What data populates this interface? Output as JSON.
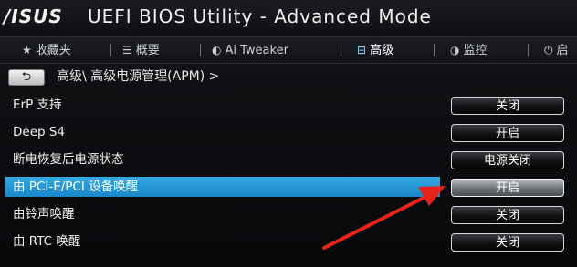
{
  "titlebar": {
    "logo": "/ISUS",
    "title": "UEFI BIOS Utility - Advanced Mode"
  },
  "nav": {
    "items": [
      {
        "icon": "star-icon",
        "glyph": "★",
        "label": "收藏夹"
      },
      {
        "icon": "list-icon",
        "glyph": "☰",
        "label": "概要"
      },
      {
        "icon": "tweaker-icon",
        "glyph": "◐",
        "label": "Ai  Tweaker"
      },
      {
        "icon": "advanced-icon",
        "glyph": "⊟",
        "label": "高级"
      },
      {
        "icon": "monitor-icon",
        "glyph": "◑",
        "label": "监控"
      },
      {
        "icon": "power-icon",
        "glyph": "⏻",
        "label": "启"
      }
    ],
    "active_index": 3,
    "accent": "#8fd2ff"
  },
  "breadcrumb": {
    "back_glyph": "⮌",
    "path": "高级\\ 高级电源管理(APM) >"
  },
  "settings": [
    {
      "label": "ErP 支持",
      "value": "关闭",
      "selected": false
    },
    {
      "label": "Deep S4",
      "value": "开启",
      "selected": false
    },
    {
      "label": "断电恢复后电源状态",
      "value": "电源关闭",
      "selected": false
    },
    {
      "label": "由 PCI-E/PCI 设备唤醒",
      "value": "开启",
      "selected": true
    },
    {
      "label": "由铃声唤醒",
      "value": "关闭",
      "selected": false
    },
    {
      "label": "由 RTC 唤醒",
      "value": "关闭",
      "selected": false
    }
  ],
  "colors": {
    "selection": "#1f93d3",
    "annotation_arrow": "#e8231c"
  }
}
